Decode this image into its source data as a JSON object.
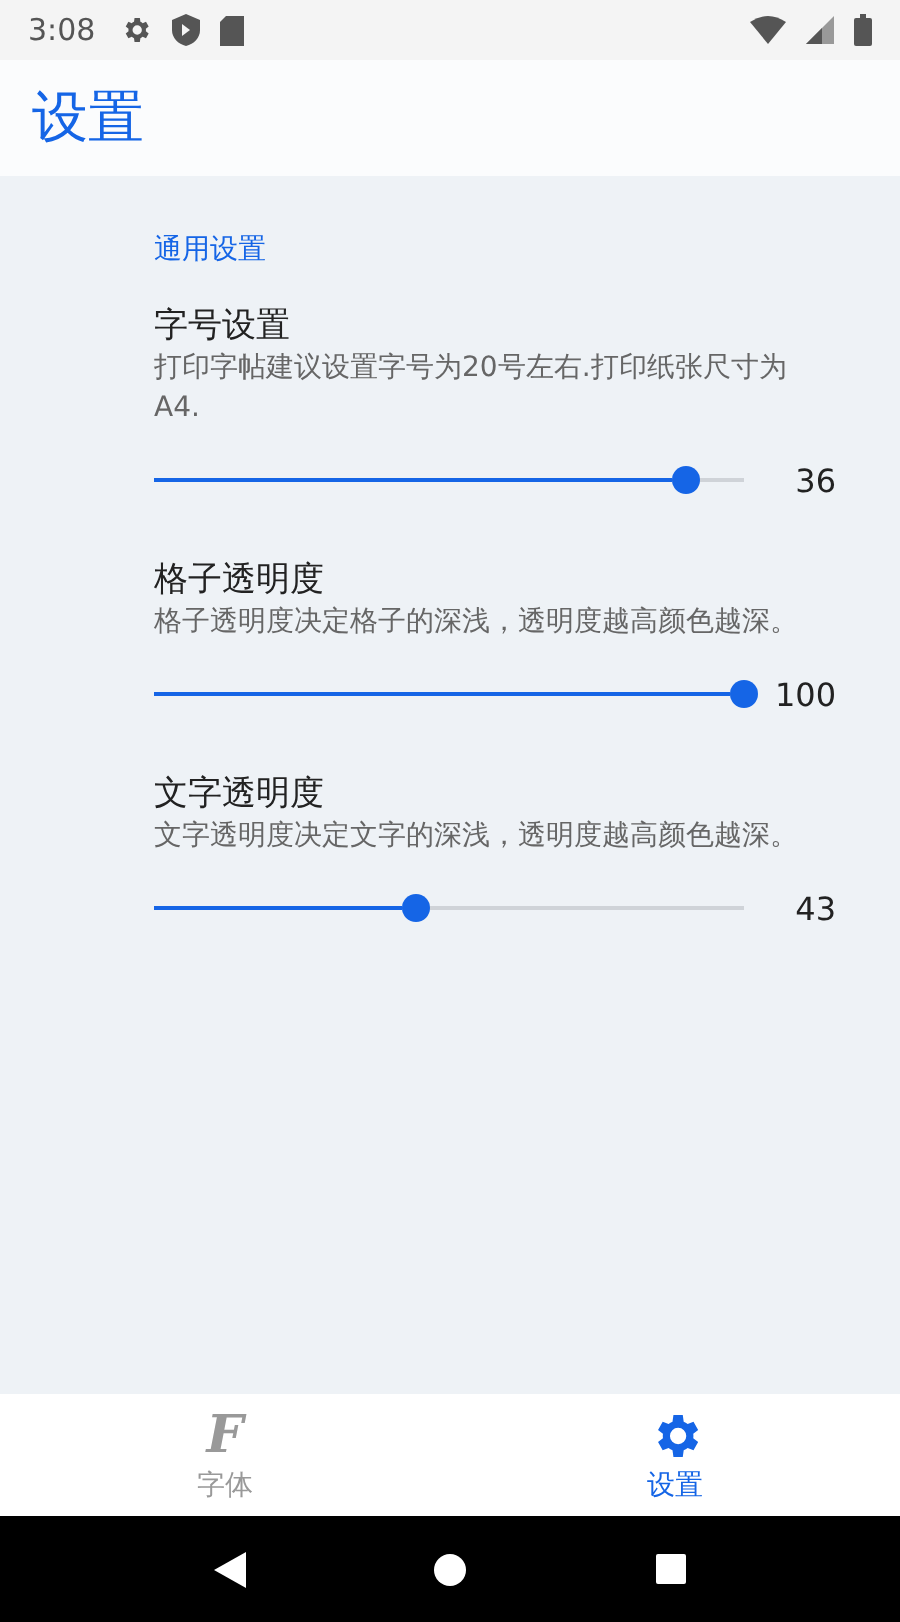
{
  "status_bar": {
    "time": "3:08"
  },
  "header": {
    "title": "设置"
  },
  "section": {
    "title": "通用设置"
  },
  "settings": [
    {
      "title": "字号设置",
      "description": "打印字帖建议设置字号为20号左右.打印纸张尺寸为A4.",
      "level": 0.9,
      "reading": "36"
    },
    {
      "title": "格子透明度",
      "description": "格子透明度决定格子的深浅，透明度越高颜色越深。",
      "level": 1.0,
      "reading": "100"
    },
    {
      "title": "文字透明度",
      "description": "文字透明度决定文字的深浅，透明度越高颜色越深。",
      "level": 0.43,
      "reading": "43"
    }
  ],
  "bottom_nav": [
    {
      "kind": "letter",
      "icon": "F",
      "label": "字体",
      "selected": false
    },
    {
      "kind": "gear",
      "label": "设置",
      "selected": true
    }
  ]
}
